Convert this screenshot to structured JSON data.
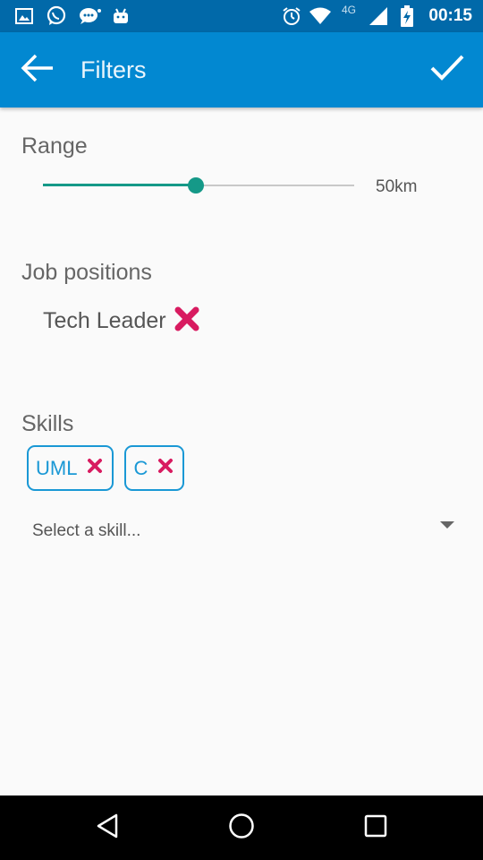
{
  "status_bar": {
    "time": "00:15",
    "network": "4G",
    "left_icons": [
      "image-icon",
      "whatsapp-icon",
      "chat-icon",
      "android-icon"
    ],
    "right_icons": [
      "alarm-icon",
      "wifi-icon",
      "signal-icon",
      "battery-icon"
    ]
  },
  "app_bar": {
    "title": "Filters",
    "back_icon": "arrow-back-icon",
    "done_icon": "check-icon",
    "color": "#0288d1"
  },
  "range": {
    "title": "Range",
    "value_label": "50km",
    "slider_fraction": 0.49,
    "accent_color": "#159988"
  },
  "job_positions": {
    "title": "Job positions",
    "items": [
      {
        "label": "Tech Leader",
        "remove_icon": "close-icon"
      }
    ]
  },
  "skills": {
    "title": "Skills",
    "chips": [
      {
        "label": "UML",
        "remove_icon": "close-icon"
      },
      {
        "label": "C",
        "remove_icon": "close-icon"
      }
    ],
    "select_placeholder": "Select a skill...",
    "chip_color": "#1a98d5",
    "remove_color": "#d81b60"
  },
  "nav_bar": {
    "icons": [
      "back-triangle-icon",
      "home-circle-icon",
      "recents-square-icon"
    ]
  }
}
